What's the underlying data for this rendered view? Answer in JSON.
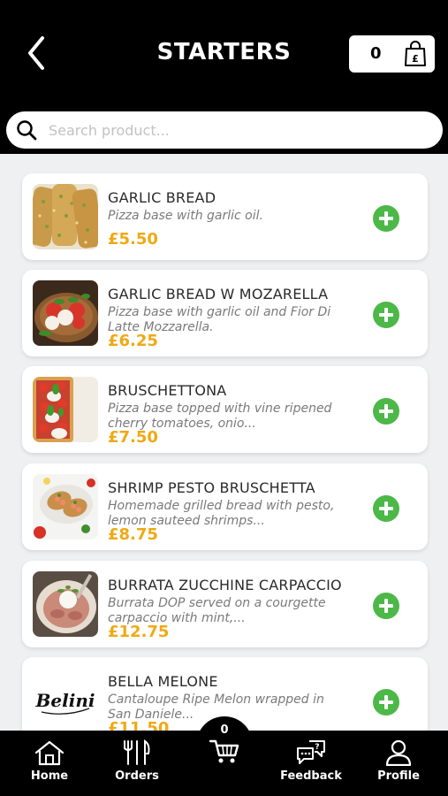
{
  "header": {
    "title": "STARTERS",
    "cart_count": "0"
  },
  "search": {
    "placeholder": "Search product..."
  },
  "products": [
    {
      "name": "GARLIC BREAD",
      "desc": "Pizza base with garlic oil.",
      "price": "£5.50"
    },
    {
      "name": "GARLIC BREAD W MOZARELLA",
      "desc": "Pizza base with garlic oil and Fior Di Latte Mozzarella.",
      "price": "£6.25"
    },
    {
      "name": "BRUSCHETTONA",
      "desc": "Pizza base topped with vine ripened cherry tomatoes, onio...",
      "price": "£7.50"
    },
    {
      "name": "SHRIMP PESTO BRUSCHETTA",
      "desc": "Homemade grilled bread with pesto, lemon sauteed shrimps...",
      "price": "£8.75"
    },
    {
      "name": "BURRATA ZUCCHINE CARPACCIO",
      "desc": "Burrata DOP served on a courgette carpaccio with mint,...",
      "price": "£12.75"
    },
    {
      "name": "BELLA MELONE",
      "desc": "Cantaloupe Ripe Melon wrapped in San Daniele...",
      "price": "£11.50"
    }
  ],
  "logo_text": "Belini",
  "nav": {
    "home": "Home",
    "orders": "Orders",
    "cart_count": "0",
    "feedback": "Feedback",
    "profile": "Profile"
  },
  "colors": {
    "accent_price": "#f0a914",
    "add_button": "#4cb848",
    "header_bg": "#000000"
  }
}
